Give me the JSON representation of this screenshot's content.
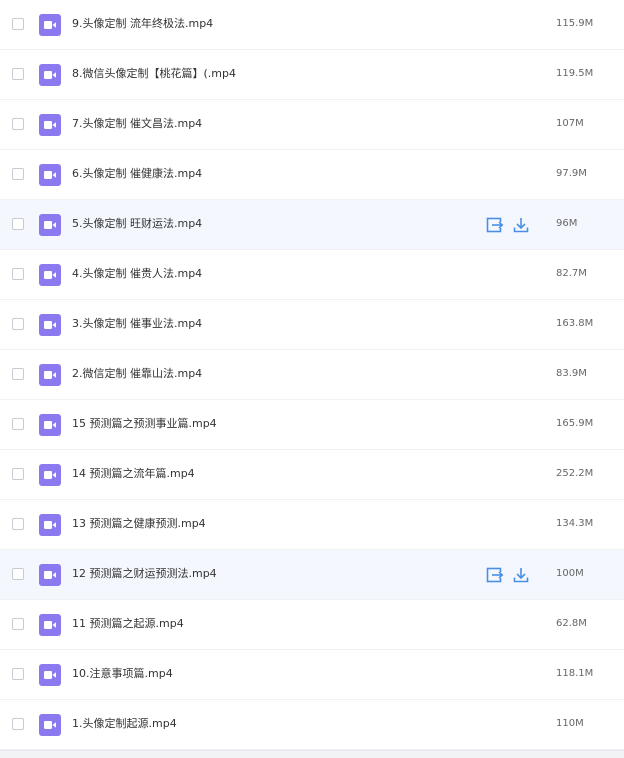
{
  "files": [
    {
      "name": "9.头像定制 流年终极法.mp4",
      "size": "115.9M",
      "icon": "video-file-icon"
    },
    {
      "name": "8.微信头像定制【桃花篇】(.mp4",
      "size": "119.5M",
      "icon": "video-file-icon"
    },
    {
      "name": "7.头像定制 催文昌法.mp4",
      "size": "107M",
      "icon": "video-file-icon"
    },
    {
      "name": "6.头像定制 催健康法.mp4",
      "size": "97.9M",
      "icon": "video-file-icon"
    },
    {
      "name": "5.头像定制 旺财运法.mp4",
      "size": "96M",
      "icon": "video-file-icon",
      "hovered": true
    },
    {
      "name": "4.头像定制 催贵人法.mp4",
      "size": "82.7M",
      "icon": "video-file-icon"
    },
    {
      "name": "3.头像定制 催事业法.mp4",
      "size": "163.8M",
      "icon": "video-file-icon"
    },
    {
      "name": "2.微信定制 催靠山法.mp4",
      "size": "83.9M",
      "icon": "video-file-icon"
    },
    {
      "name": "15 预测篇之预测事业篇.mp4",
      "size": "165.9M",
      "icon": "video-file-icon"
    },
    {
      "name": "14 预测篇之流年篇.mp4",
      "size": "252.2M",
      "icon": "video-file-icon"
    },
    {
      "name": "13 预测篇之健康预测.mp4",
      "size": "134.3M",
      "icon": "video-file-icon"
    },
    {
      "name": "12 预测篇之财运预测法.mp4",
      "size": "100M",
      "icon": "video-file-icon",
      "hovered": true
    },
    {
      "name": "11 预测篇之起源.mp4",
      "size": "62.8M",
      "icon": "video-file-icon"
    },
    {
      "name": "10.注意事项篇.mp4",
      "size": "118.1M",
      "icon": "video-file-icon"
    },
    {
      "name": "1.头像定制起源.mp4",
      "size": "110M",
      "icon": "video-file-icon"
    }
  ],
  "row_actions": {
    "share_icon": "share-icon",
    "download_icon": "download-icon"
  },
  "colors": {
    "file_icon": "#8b79f0",
    "action_icon": "#4a8ee6",
    "hover_row": "#f4f8fe"
  }
}
